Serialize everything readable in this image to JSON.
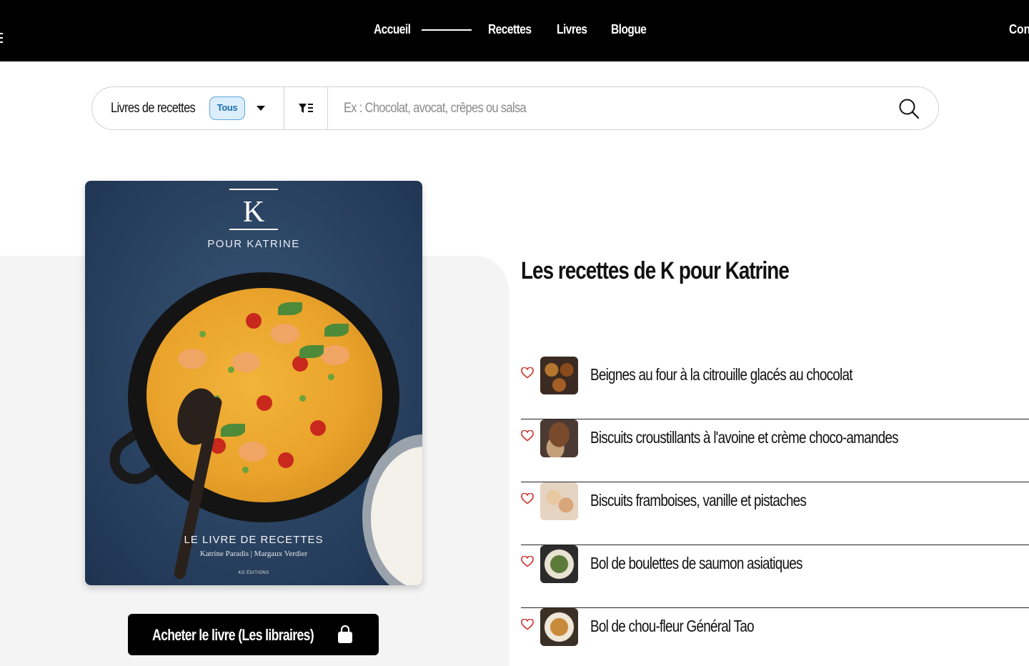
{
  "nav": {
    "links": [
      "Accueil",
      "Recettes",
      "Livres",
      "Blogue"
    ],
    "account_label": "Con"
  },
  "search": {
    "category_label": "Livres de recettes",
    "filter_pill": "Tous",
    "placeholder": "Ex : Chocolat, avocat, crêpes ou salsa"
  },
  "book": {
    "cover": {
      "letter": "K",
      "brand": "POUR KATRINE",
      "title": "LE LIVRE DE RECETTES",
      "authors": "Katrine Paradis | Margaux Verdier",
      "publisher": "KO ÉDITIONS"
    },
    "buy_label": "Acheter le livre (Les libraires)"
  },
  "heading": {
    "prefix": "Les recettes de ",
    "bold": "K pour Katrine"
  },
  "recipes": [
    {
      "title": "Beignes au four à la citrouille glacés au chocolat",
      "thumb": "donuts"
    },
    {
      "title": "Biscuits croustillants à l'avoine et crème choco-amandes",
      "thumb": "cookies"
    },
    {
      "title": "Biscuits framboises, vanille et pistaches",
      "thumb": "raspberry-cookies"
    },
    {
      "title": "Bol de boulettes de saumon asiatiques",
      "thumb": "salmon-bowl"
    },
    {
      "title": "Bol de chou-fleur Général Tao",
      "thumb": "cauliflower-bowl"
    }
  ],
  "colors": {
    "nav_bg": "#000000",
    "pill_bg": "#dceefb",
    "pill_border": "#5aa8e0",
    "heart": "#d0322d",
    "panel_bg": "#f4f4f4"
  }
}
